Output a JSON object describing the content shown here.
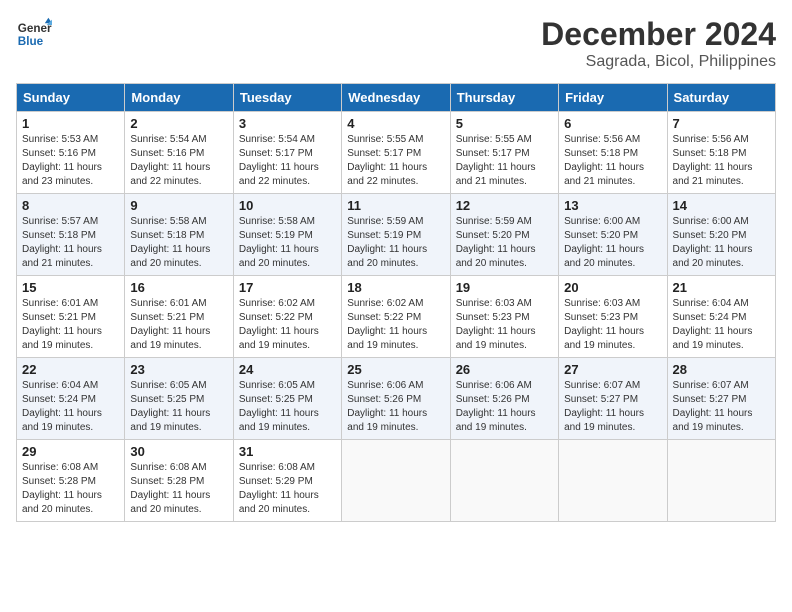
{
  "logo": {
    "line1": "General",
    "line2": "Blue"
  },
  "title": "December 2024",
  "location": "Sagrada, Bicol, Philippines",
  "days_of_week": [
    "Sunday",
    "Monday",
    "Tuesday",
    "Wednesday",
    "Thursday",
    "Friday",
    "Saturday"
  ],
  "weeks": [
    [
      {
        "day": "1",
        "detail": "Sunrise: 5:53 AM\nSunset: 5:16 PM\nDaylight: 11 hours\nand 23 minutes."
      },
      {
        "day": "2",
        "detail": "Sunrise: 5:54 AM\nSunset: 5:16 PM\nDaylight: 11 hours\nand 22 minutes."
      },
      {
        "day": "3",
        "detail": "Sunrise: 5:54 AM\nSunset: 5:17 PM\nDaylight: 11 hours\nand 22 minutes."
      },
      {
        "day": "4",
        "detail": "Sunrise: 5:55 AM\nSunset: 5:17 PM\nDaylight: 11 hours\nand 22 minutes."
      },
      {
        "day": "5",
        "detail": "Sunrise: 5:55 AM\nSunset: 5:17 PM\nDaylight: 11 hours\nand 21 minutes."
      },
      {
        "day": "6",
        "detail": "Sunrise: 5:56 AM\nSunset: 5:18 PM\nDaylight: 11 hours\nand 21 minutes."
      },
      {
        "day": "7",
        "detail": "Sunrise: 5:56 AM\nSunset: 5:18 PM\nDaylight: 11 hours\nand 21 minutes."
      }
    ],
    [
      {
        "day": "8",
        "detail": "Sunrise: 5:57 AM\nSunset: 5:18 PM\nDaylight: 11 hours\nand 21 minutes."
      },
      {
        "day": "9",
        "detail": "Sunrise: 5:58 AM\nSunset: 5:18 PM\nDaylight: 11 hours\nand 20 minutes."
      },
      {
        "day": "10",
        "detail": "Sunrise: 5:58 AM\nSunset: 5:19 PM\nDaylight: 11 hours\nand 20 minutes."
      },
      {
        "day": "11",
        "detail": "Sunrise: 5:59 AM\nSunset: 5:19 PM\nDaylight: 11 hours\nand 20 minutes."
      },
      {
        "day": "12",
        "detail": "Sunrise: 5:59 AM\nSunset: 5:20 PM\nDaylight: 11 hours\nand 20 minutes."
      },
      {
        "day": "13",
        "detail": "Sunrise: 6:00 AM\nSunset: 5:20 PM\nDaylight: 11 hours\nand 20 minutes."
      },
      {
        "day": "14",
        "detail": "Sunrise: 6:00 AM\nSunset: 5:20 PM\nDaylight: 11 hours\nand 20 minutes."
      }
    ],
    [
      {
        "day": "15",
        "detail": "Sunrise: 6:01 AM\nSunset: 5:21 PM\nDaylight: 11 hours\nand 19 minutes."
      },
      {
        "day": "16",
        "detail": "Sunrise: 6:01 AM\nSunset: 5:21 PM\nDaylight: 11 hours\nand 19 minutes."
      },
      {
        "day": "17",
        "detail": "Sunrise: 6:02 AM\nSunset: 5:22 PM\nDaylight: 11 hours\nand 19 minutes."
      },
      {
        "day": "18",
        "detail": "Sunrise: 6:02 AM\nSunset: 5:22 PM\nDaylight: 11 hours\nand 19 minutes."
      },
      {
        "day": "19",
        "detail": "Sunrise: 6:03 AM\nSunset: 5:23 PM\nDaylight: 11 hours\nand 19 minutes."
      },
      {
        "day": "20",
        "detail": "Sunrise: 6:03 AM\nSunset: 5:23 PM\nDaylight: 11 hours\nand 19 minutes."
      },
      {
        "day": "21",
        "detail": "Sunrise: 6:04 AM\nSunset: 5:24 PM\nDaylight: 11 hours\nand 19 minutes."
      }
    ],
    [
      {
        "day": "22",
        "detail": "Sunrise: 6:04 AM\nSunset: 5:24 PM\nDaylight: 11 hours\nand 19 minutes."
      },
      {
        "day": "23",
        "detail": "Sunrise: 6:05 AM\nSunset: 5:25 PM\nDaylight: 11 hours\nand 19 minutes."
      },
      {
        "day": "24",
        "detail": "Sunrise: 6:05 AM\nSunset: 5:25 PM\nDaylight: 11 hours\nand 19 minutes."
      },
      {
        "day": "25",
        "detail": "Sunrise: 6:06 AM\nSunset: 5:26 PM\nDaylight: 11 hours\nand 19 minutes."
      },
      {
        "day": "26",
        "detail": "Sunrise: 6:06 AM\nSunset: 5:26 PM\nDaylight: 11 hours\nand 19 minutes."
      },
      {
        "day": "27",
        "detail": "Sunrise: 6:07 AM\nSunset: 5:27 PM\nDaylight: 11 hours\nand 19 minutes."
      },
      {
        "day": "28",
        "detail": "Sunrise: 6:07 AM\nSunset: 5:27 PM\nDaylight: 11 hours\nand 19 minutes."
      }
    ],
    [
      {
        "day": "29",
        "detail": "Sunrise: 6:08 AM\nSunset: 5:28 PM\nDaylight: 11 hours\nand 20 minutes."
      },
      {
        "day": "30",
        "detail": "Sunrise: 6:08 AM\nSunset: 5:28 PM\nDaylight: 11 hours\nand 20 minutes."
      },
      {
        "day": "31",
        "detail": "Sunrise: 6:08 AM\nSunset: 5:29 PM\nDaylight: 11 hours\nand 20 minutes."
      },
      {
        "day": "",
        "detail": ""
      },
      {
        "day": "",
        "detail": ""
      },
      {
        "day": "",
        "detail": ""
      },
      {
        "day": "",
        "detail": ""
      }
    ]
  ]
}
